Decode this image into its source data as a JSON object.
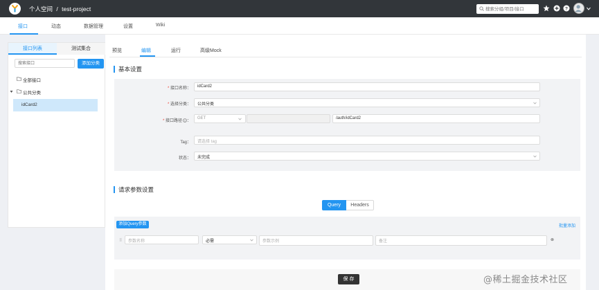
{
  "topbar": {
    "breadcrumb_space": "个人空间",
    "breadcrumb_sep": "/",
    "breadcrumb_project": "test-project",
    "search_placeholder": "搜索分组/项目/接口"
  },
  "subnav": {
    "tabs": [
      "接口",
      "动态",
      "数据管理",
      "设置",
      "Wiki"
    ],
    "active": "接口"
  },
  "left": {
    "tabs": [
      "接口列表",
      "测试集合"
    ],
    "search_placeholder": "搜索接口",
    "add_category": "添加分类",
    "tree": {
      "all": "全部接口",
      "category": "公共分类",
      "selected_api": "idCard2"
    }
  },
  "main": {
    "tabs": [
      "预览",
      "编辑",
      "运行",
      "高级Mock"
    ],
    "active_tab": "编辑",
    "basic": {
      "title": "基本设置",
      "api_name_label": "接口名称：",
      "api_name_value": "idCard2",
      "category_label": "选择分类：",
      "category_value": "公共分类",
      "path_label": "接口路径",
      "path_label_suffix": "：",
      "method_value": "GET",
      "path_value": "/auth/idCard2",
      "tag_label": "Tag：",
      "tag_placeholder": "请选择 tag",
      "status_label": "状态：",
      "status_value": "未完成"
    },
    "request": {
      "title": "请求参数设置",
      "seg_query": "Query",
      "seg_headers": "Headers",
      "add_query": "添加Query参数",
      "bulk_add": "批量添加",
      "param_name_placeholder": "参数名称",
      "required_value": "必需",
      "example_placeholder": "参数示例",
      "remark_placeholder": "备注",
      "delete_glyph": "⊗",
      "grip_glyph": "⠿"
    },
    "save": "保 存"
  },
  "watermark": "@稀土掘金技术社区",
  "colors": {
    "topbar": "#32363a",
    "accent": "#2395f1",
    "required": "#f04134",
    "panel": "#f2f3f5"
  }
}
